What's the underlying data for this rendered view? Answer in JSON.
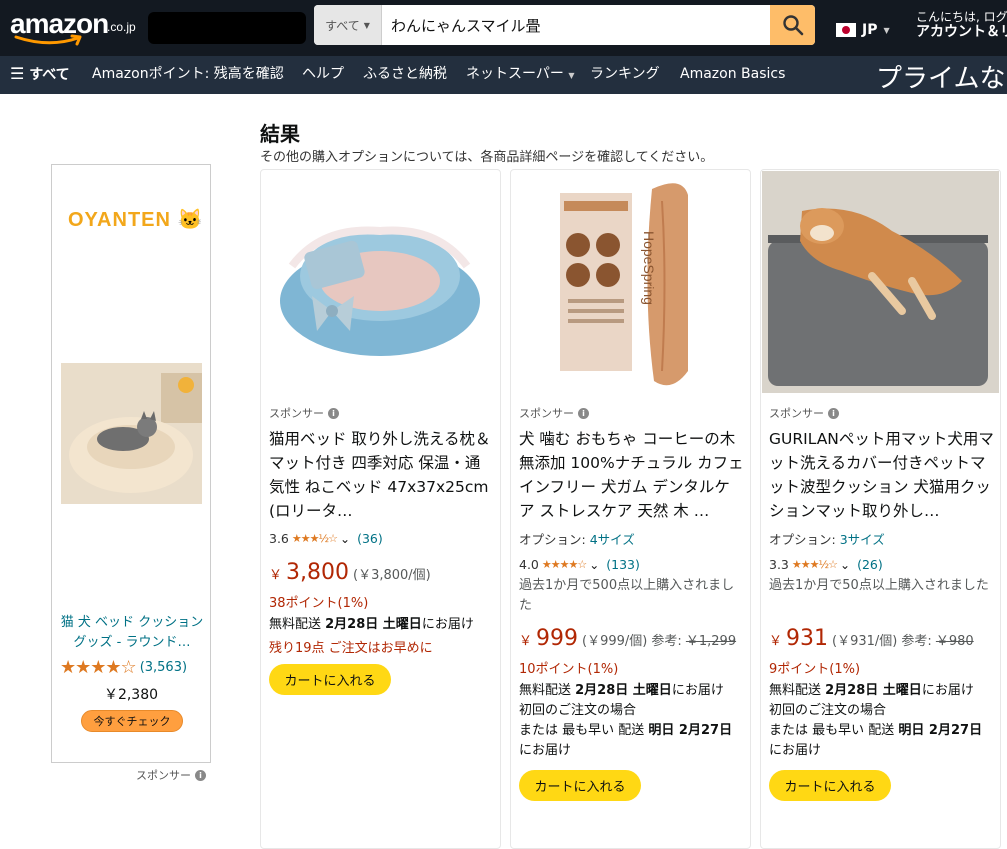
{
  "header": {
    "logo_text": "amazon",
    "logo_tld": ".co.jp",
    "search_category": "すべて",
    "search_value": "わんにゃんスマイル畳",
    "language": "JP",
    "account_line1": "こんにちは, ログ",
    "account_line2": "アカウント＆リ",
    "colors": {
      "nav_bg": "#131921",
      "subnav_bg": "#232f3e",
      "search_button": "#febd69",
      "accent": "#ff9900"
    }
  },
  "subnav": {
    "all_label": "すべて",
    "items": [
      "Amazonポイント: 残高を確認",
      "ヘルプ",
      "ふるさと納税",
      "ネットスーパー",
      "ランキング",
      "Amazon Basics"
    ],
    "prime_banner": "プライムなら"
  },
  "sidebar_ad": {
    "brand": "OYANTEN",
    "title": "猫 犬 ベッド クッション グッズ - ラウンド…",
    "rating_stars": "★★★★☆",
    "rating_value": 4.0,
    "review_count": "(3,563)",
    "price": "￥2,380",
    "cta": "今すぐチェック",
    "sponsor_label": "スポンサー"
  },
  "results": {
    "heading": "結果",
    "subheading": "その他の購入オプションについては、各商品詳細ページを確認してください。",
    "sponsor_label": "スポンサー",
    "cart_label": "カートに入れる",
    "products": [
      {
        "title": "猫用ベッド 取り外し洗える枕＆マット付き 四季対応 保温・通気性 ねこベッド 47x37x25cm (ロリータ…",
        "rating": "3.6",
        "stars": "★★★½☆",
        "review_count": "(36)",
        "price_symbol": "￥",
        "price": "3,800",
        "unit_price": "(￥3,800/個)",
        "points": "38ポイント(1%)",
        "ship_prefix": "無料配送 ",
        "ship_date": "2月28日 土曜日",
        "ship_suffix": "にお届け",
        "stock": "残り19点 ご注文はお早めに"
      },
      {
        "title": "犬 噛む おもちゃ コーヒーの木 無添加 100%ナチュラル カフェインフリー 犬ガム デンタルケア ストレスケア 天然 木 …",
        "option_label": "オプション: ",
        "option_value": "4サイズ",
        "rating": "4.0",
        "stars": "★★★★☆",
        "review_count": "(133)",
        "bought": "過去1か月で500点以上購入されました",
        "price_symbol": "￥",
        "price": "999",
        "unit_price": "(￥999/個)",
        "ref_label": "参考: ",
        "ref_price": "￥1,299",
        "points": "10ポイント(1%)",
        "ship_prefix": "無料配送 ",
        "ship_date": "2月28日 土曜日",
        "ship_suffix": "にお届け",
        "ship_line2": "初回のご注文の場合",
        "fast_prefix": "または 最も早い 配送 ",
        "fast_date": "明日 2月27日",
        "fast_suffix": "にお届け",
        "image_text": "HopeSpring"
      },
      {
        "title": "GURILANペット用マット犬用マット洗えるカバー付きペットマット波型クッション 犬猫用クッションマット取り外し…",
        "option_label": "オプション: ",
        "option_value": "3サイズ",
        "rating": "3.3",
        "stars": "★★★½☆",
        "review_count": "(26)",
        "bought": "過去1か月で50点以上購入されました",
        "price_symbol": "￥",
        "price": "931",
        "unit_price": "(￥931/個)",
        "ref_label": "参考: ",
        "ref_price": "￥980",
        "points": "9ポイント(1%)",
        "ship_prefix": "無料配送 ",
        "ship_date": "2月28日 土曜日",
        "ship_suffix": "にお届け",
        "ship_line2": "初回のご注文の場合",
        "fast_prefix": "または 最も早い 配送 ",
        "fast_date": "明日 2月27日",
        "fast_suffix": "にお届け"
      }
    ]
  }
}
